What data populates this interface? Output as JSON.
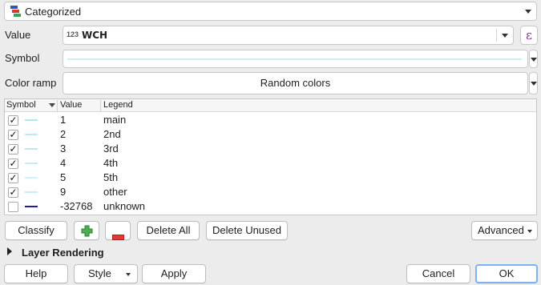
{
  "renderer": {
    "label": "Categorized"
  },
  "value_field": {
    "label": "Value",
    "type_badge": "123",
    "value": "WCH",
    "expr_symbol": "ε"
  },
  "symbol": {
    "label": "Symbol",
    "preview_color": "#cdeef6"
  },
  "color_ramp": {
    "label": "Color ramp",
    "value": "Random colors"
  },
  "table": {
    "headers": {
      "symbol": "Symbol",
      "value": "Value",
      "legend": "Legend"
    },
    "rows": [
      {
        "checked": true,
        "check_glyph": "✓",
        "value": "1",
        "legend": "main",
        "color": "#b5e6f0"
      },
      {
        "checked": true,
        "check_glyph": "✓",
        "value": "2",
        "legend": "2nd",
        "color": "#bde9f2"
      },
      {
        "checked": true,
        "check_glyph": "✓",
        "value": "3",
        "legend": "3rd",
        "color": "#bfe8ee"
      },
      {
        "checked": true,
        "check_glyph": "✓",
        "value": "4",
        "legend": "4th",
        "color": "#c6ecf3"
      },
      {
        "checked": true,
        "check_glyph": "✓",
        "value": "5",
        "legend": "5th",
        "color": "#d2f0f6"
      },
      {
        "checked": true,
        "check_glyph": "✓",
        "value": "9",
        "legend": "other",
        "color": "#c9edf4"
      },
      {
        "checked": false,
        "check_glyph": "",
        "value": "-32768",
        "legend": "unknown",
        "color": "#1d1d9c"
      }
    ]
  },
  "buttons": {
    "classify": "Classify",
    "add_icon": "plus-icon",
    "remove_icon": "minus-icon",
    "delete_all": "Delete All",
    "delete_unused": "Delete Unused",
    "advanced": "Advanced"
  },
  "layer_rendering": {
    "label": "Layer Rendering"
  },
  "footer": {
    "help": "Help",
    "style": "Style",
    "apply": "Apply",
    "cancel": "Cancel",
    "ok": "OK"
  }
}
